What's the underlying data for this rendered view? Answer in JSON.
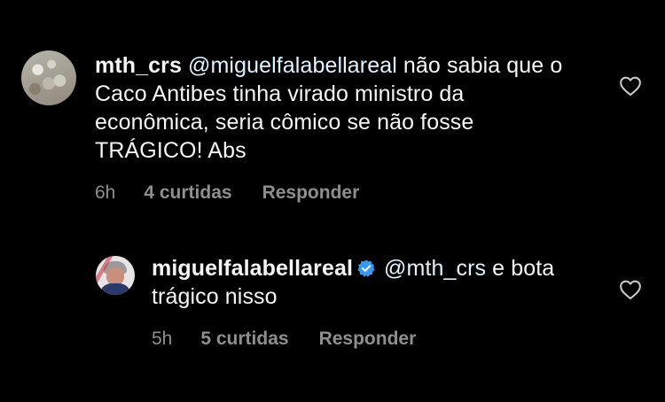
{
  "comments": [
    {
      "username": "mth_crs",
      "mention": "@miguelfalabellareal",
      "text": " não sabia que o Caco Antibes tinha virado ministro da econômica, seria cômico se não fosse TRÁGICO! Abs",
      "time": "6h",
      "likes": "4 curtidas",
      "reply_label": "Responder",
      "avatar_icon": "user-avatar",
      "like_icon": "heart-outline-icon"
    },
    {
      "username": "miguelfalabellareal",
      "verified": true,
      "mention": "@mth_crs",
      "text": " e bota trágico nisso",
      "time": "5h",
      "likes": "5 curtidas",
      "reply_label": "Responder",
      "avatar_icon": "user-avatar",
      "like_icon": "heart-outline-icon"
    }
  ],
  "colors": {
    "background": "#000000",
    "text": "#f5f5f5",
    "mention": "#e0f1ff",
    "secondary": "#8e8e8e",
    "verified": "#3897f0"
  }
}
